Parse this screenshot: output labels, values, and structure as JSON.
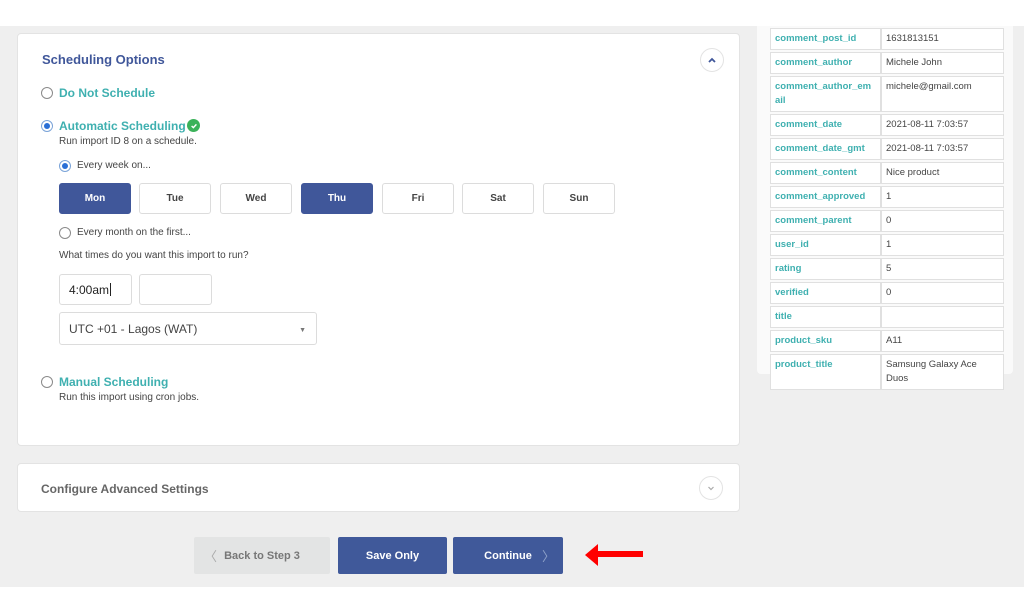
{
  "scheduling": {
    "title": "Scheduling Options",
    "options": [
      {
        "label": "Do Not Schedule",
        "selected": false
      },
      {
        "label": "Automatic Scheduling",
        "selected": true,
        "description": "Run import ID 8 on a schedule.",
        "status_icon": "check-circle-icon"
      },
      {
        "label": "Manual Scheduling",
        "selected": false,
        "description": "Run this import using cron jobs."
      }
    ],
    "frequency": {
      "weekly_label": "Every week on...",
      "weekly_selected": true,
      "monthly_label": "Every month on the first...",
      "monthly_selected": false
    },
    "days": [
      {
        "label": "Mon",
        "selected": true
      },
      {
        "label": "Tue",
        "selected": false
      },
      {
        "label": "Wed",
        "selected": false
      },
      {
        "label": "Thu",
        "selected": true
      },
      {
        "label": "Fri",
        "selected": false
      },
      {
        "label": "Sat",
        "selected": false
      },
      {
        "label": "Sun",
        "selected": false
      }
    ],
    "times_question": "What times do you want this import to run?",
    "time_values": [
      "4:00am",
      ""
    ],
    "timezone": "UTC +01 - Lagos (WAT)"
  },
  "advanced": {
    "title": "Configure Advanced Settings"
  },
  "preview_table": [
    {
      "key": "comment_post_id",
      "value": "1631813151"
    },
    {
      "key": "comment_author",
      "value": "Michele John"
    },
    {
      "key": "comment_author_email",
      "value": "michele@gmail.com"
    },
    {
      "key": "comment_date",
      "value": "2021-08-11 7:03:57"
    },
    {
      "key": "comment_date_gmt",
      "value": "2021-08-11 7:03:57"
    },
    {
      "key": "comment_content",
      "value": "Nice product"
    },
    {
      "key": "comment_approved",
      "value": "1"
    },
    {
      "key": "comment_parent",
      "value": "0"
    },
    {
      "key": "user_id",
      "value": "1"
    },
    {
      "key": "rating",
      "value": "5"
    },
    {
      "key": "verified",
      "value": "0"
    },
    {
      "key": "title",
      "value": ""
    },
    {
      "key": "product_sku",
      "value": "A11"
    },
    {
      "key": "product_title",
      "value": "Samsung Galaxy Ace Duos"
    }
  ],
  "footer": {
    "back_label": "Back to Step 3",
    "save_label": "Save Only",
    "continue_label": "Continue"
  },
  "colors": {
    "primary": "#40599a",
    "accent_teal": "#3fb0b0",
    "success": "#3bb25a",
    "annotation_arrow": "#ff0000"
  }
}
